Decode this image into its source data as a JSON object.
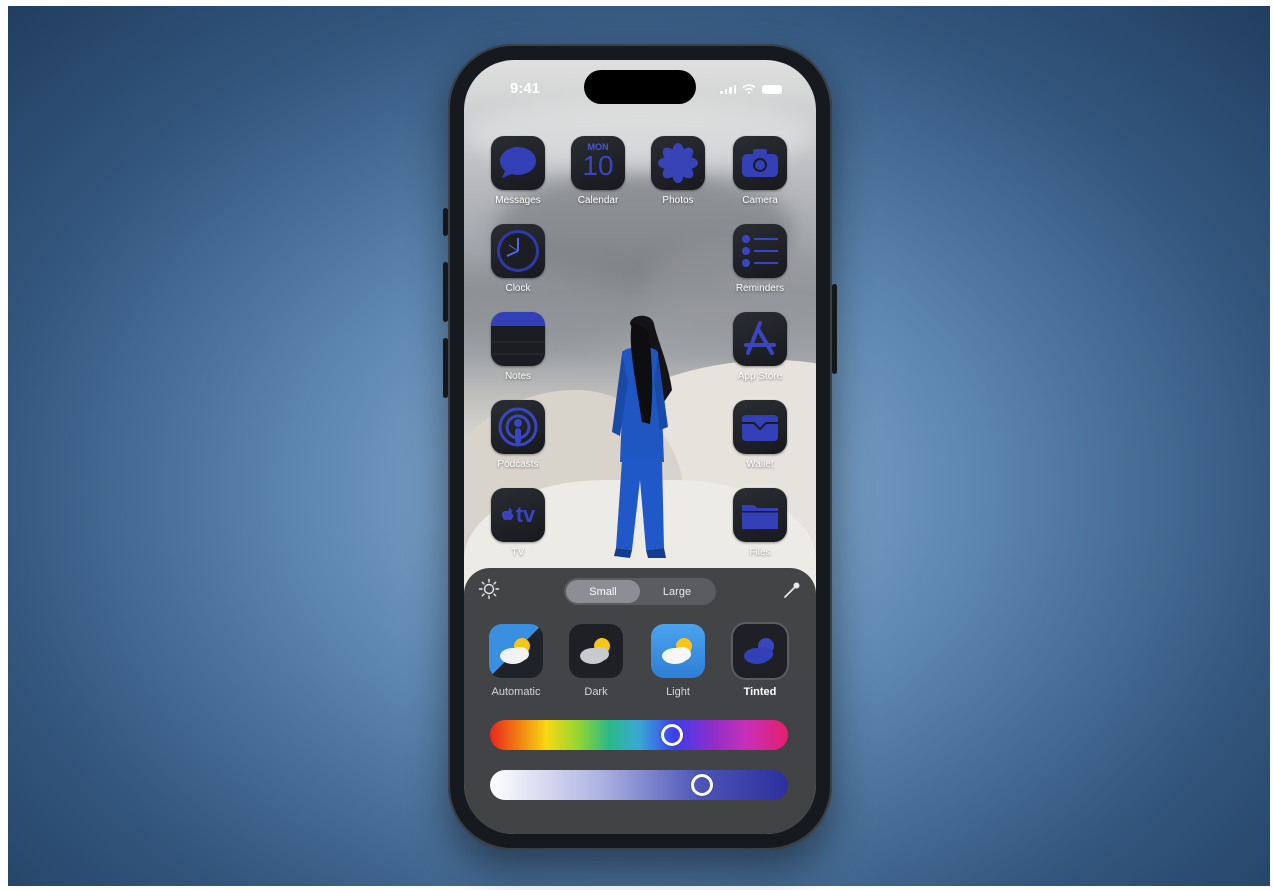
{
  "status_bar": {
    "time": "9:41"
  },
  "apps": [
    {
      "label": "Messages",
      "icon": "messages-icon"
    },
    {
      "label": "Calendar",
      "icon": "calendar-icon",
      "day": "MON",
      "date": "10"
    },
    {
      "label": "Photos",
      "icon": "photos-icon"
    },
    {
      "label": "Camera",
      "icon": "camera-icon"
    },
    {
      "label": "Clock",
      "icon": "clock-icon"
    },
    {
      "label": "Reminders",
      "icon": "reminders-icon"
    },
    {
      "label": "Notes",
      "icon": "notes-icon"
    },
    {
      "label": "App Store",
      "icon": "app-store-icon"
    },
    {
      "label": "Podcasts",
      "icon": "podcasts-icon"
    },
    {
      "label": "Wallet",
      "icon": "wallet-icon"
    },
    {
      "label": "TV",
      "icon": "tv-icon",
      "glyph": "tv"
    },
    {
      "label": "Files",
      "icon": "files-icon"
    }
  ],
  "customize": {
    "size_options": [
      "Small",
      "Large"
    ],
    "selected_size": "Small",
    "styles": [
      {
        "label": "Automatic",
        "icon": "weather-automatic-icon"
      },
      {
        "label": "Dark",
        "icon": "weather-dark-icon"
      },
      {
        "label": "Light",
        "icon": "weather-light-icon"
      },
      {
        "label": "Tinted",
        "icon": "weather-tinted-icon",
        "selected": true
      }
    ],
    "hue_level": 0.61,
    "saturation_level": 0.71
  },
  "colors": {
    "tint": "#3340b8",
    "background": "#3a6590"
  }
}
